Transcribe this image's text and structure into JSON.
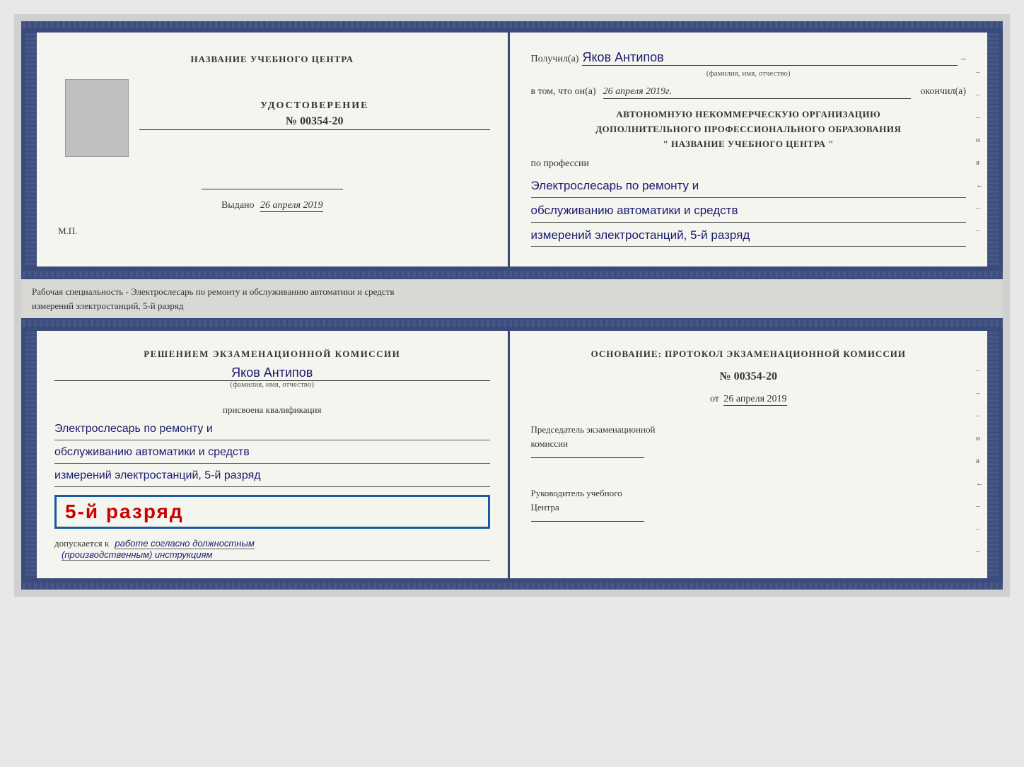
{
  "top_left": {
    "org_name": "НАЗВАНИЕ УЧЕБНОГО ЦЕНТРА",
    "udostoverenie_label": "УДОСТОВЕРЕНИЕ",
    "number": "№ 00354-20",
    "vydano_label": "Выдано",
    "vydano_date": "26 апреля 2019",
    "mp_label": "М.П."
  },
  "top_right": {
    "received_label": "Получил(а)",
    "received_name": "Яков Антипов",
    "fio_hint": "(фамилия, имя, отчество)",
    "dash": "–",
    "vtom_label": "в том, что он(а)",
    "vtom_date": "26 апреля 2019г.",
    "okonchil_label": "окончил(а)",
    "avtonomnuyu_line1": "АВТОНОМНУЮ НЕКОММЕРЧЕСКУЮ ОРГАНИЗАЦИЮ",
    "avtonomnuyu_line2": "ДОПОЛНИТЕЛЬНОГО ПРОФЕССИОНАЛЬНОГО ОБРАЗОВАНИЯ",
    "org_name_quotes": "\"   НАЗВАНИЕ УЧЕБНОГО ЦЕНТРА   \"",
    "po_professii_label": "по профессии",
    "profession_line1": "Электрослесарь по ремонту и",
    "profession_line2": "обслуживанию автоматики и средств",
    "profession_line3": "измерений электростанций, 5-й разряд",
    "side_marks": [
      "–",
      "–",
      "–",
      "и",
      "я",
      "←",
      "–",
      "–"
    ]
  },
  "separator": {
    "text_line1": "Рабочая специальность - Электрослесарь по ремонту и обслуживанию автоматики и средств",
    "text_line2": "измерений электростанций, 5-й разряд"
  },
  "bottom_left": {
    "resheniem_label": "Решением экзаменационной комиссии",
    "name_handwritten": "Яков Антипов",
    "fio_hint": "(фамилия, имя, отчество)",
    "prisvoena_label": "присвоена квалификация",
    "qual_line1": "Электрослесарь по ремонту и",
    "qual_line2": "обслуживанию автоматики и средств",
    "qual_line3": "измерений электростанций, 5-й разряд",
    "razryad_badge": "5-й разряд",
    "dopuskaetsya_label": "допускается к",
    "dopuskaetsya_text": "работе согласно должностным",
    "dopuskaetsya_text2": "(производственным) инструкциям"
  },
  "bottom_right": {
    "osnovanie_label": "Основание: протокол экзаменационной комиссии",
    "number": "№  00354-20",
    "ot_label": "от",
    "ot_date": "26 апреля 2019",
    "predsedatel_line1": "Председатель экзаменационной",
    "predsedatel_line2": "комиссии",
    "rukovoditel_line1": "Руководитель учебного",
    "rukovoditel_line2": "Центра",
    "side_marks": [
      "–",
      "–",
      "–",
      "и",
      "я",
      "←",
      "–",
      "–",
      "–"
    ]
  }
}
